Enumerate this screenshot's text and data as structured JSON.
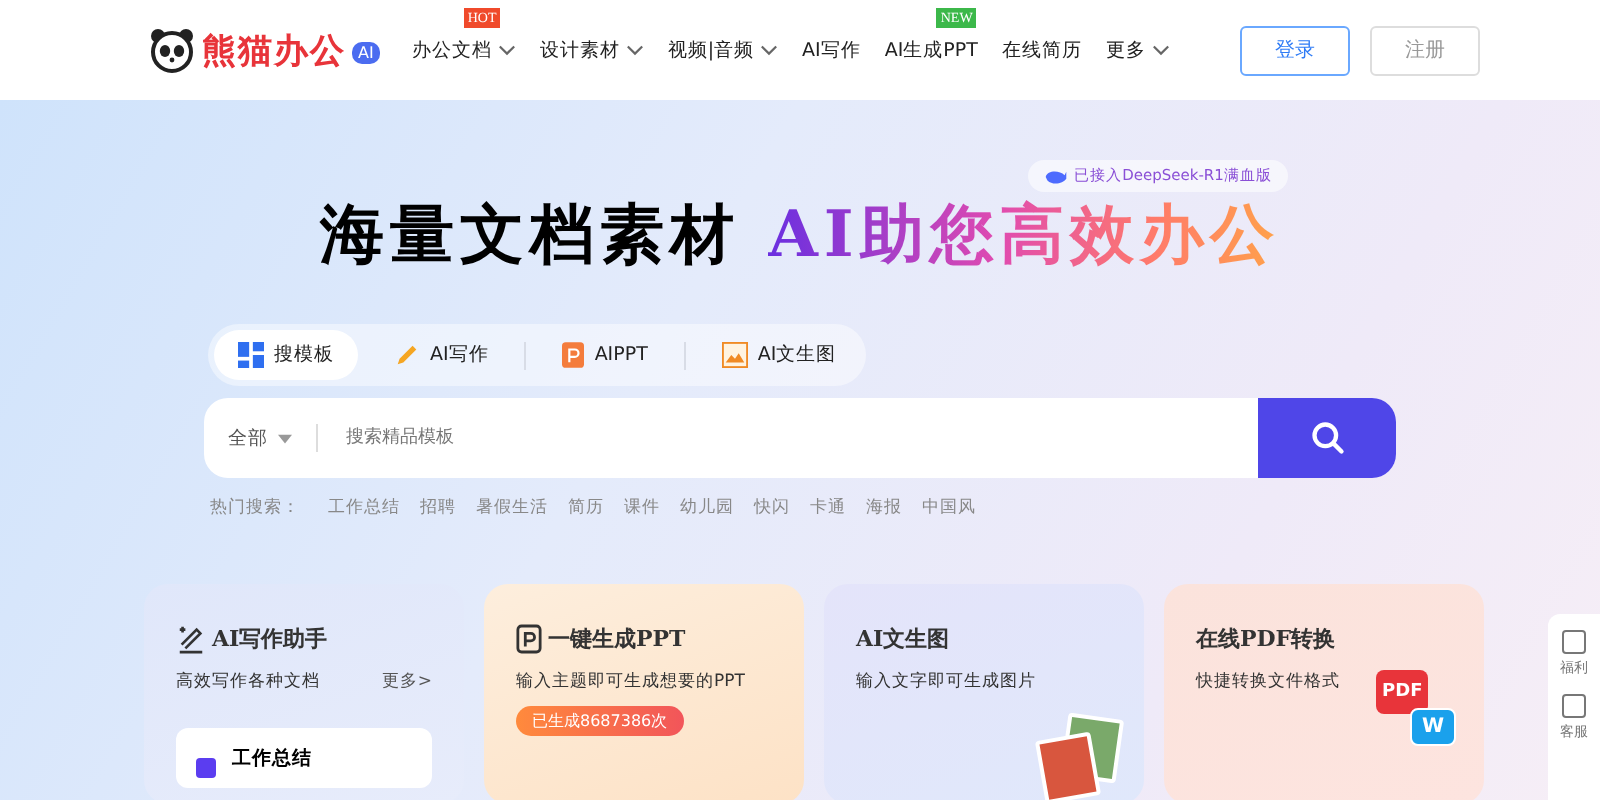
{
  "header": {
    "logo_text": "熊猫办公",
    "logo_badge": "AI",
    "nav": [
      {
        "label": "办公文档",
        "dropdown": true,
        "badge": {
          "text": "HOT",
          "color": "#f04a2b"
        }
      },
      {
        "label": "设计素材",
        "dropdown": true
      },
      {
        "label": "视频|音频",
        "dropdown": true
      },
      {
        "label": "AI写作",
        "dropdown": false
      },
      {
        "label": "AI生成PPT",
        "dropdown": false,
        "badge": {
          "text": "NEW",
          "color": "#3cb84a"
        }
      },
      {
        "label": "在线简历",
        "dropdown": false
      },
      {
        "label": "更多",
        "dropdown": true
      }
    ],
    "login": "登录",
    "register": "注册"
  },
  "hero": {
    "notice": "已接入DeepSeek-R1满血版",
    "title_plain": "海量文档素材",
    "title_gradient": "AI助您高效办公"
  },
  "search_tabs": [
    {
      "label": "搜模板",
      "kind": "grid",
      "selected": true
    },
    {
      "label": "AI写作",
      "kind": "pencil",
      "selected": false
    },
    {
      "label": "AIPPT",
      "kind": "ppt",
      "selected": false
    },
    {
      "label": "AI文生图",
      "kind": "image",
      "selected": false
    }
  ],
  "search": {
    "category": "全部",
    "placeholder": "搜索精品模板"
  },
  "hot_search": {
    "label": "热门搜索：",
    "terms": [
      "工作总结",
      "招聘",
      "暑假生活",
      "简历",
      "课件",
      "幼儿园",
      "快闪",
      "卡通",
      "海报",
      "中国风"
    ]
  },
  "cards": [
    {
      "kind": "writing",
      "title": "AI写作助手",
      "subtitle": "高效写作各种文档",
      "more": "更多>",
      "item": "工作总结"
    },
    {
      "kind": "ppt",
      "title": "一键生成PPT",
      "subtitle": "输入主题即可生成想要的PPT",
      "badge": "已生成8687386次"
    },
    {
      "kind": "image",
      "title": "AI文生图",
      "subtitle": "输入文字即可生成图片"
    },
    {
      "kind": "pdf",
      "title": "在线PDF转换",
      "subtitle": "快捷转换文件格式",
      "icon_letters": [
        "PDF",
        "W"
      ]
    }
  ],
  "side_panel": [
    "福利",
    "客服"
  ]
}
